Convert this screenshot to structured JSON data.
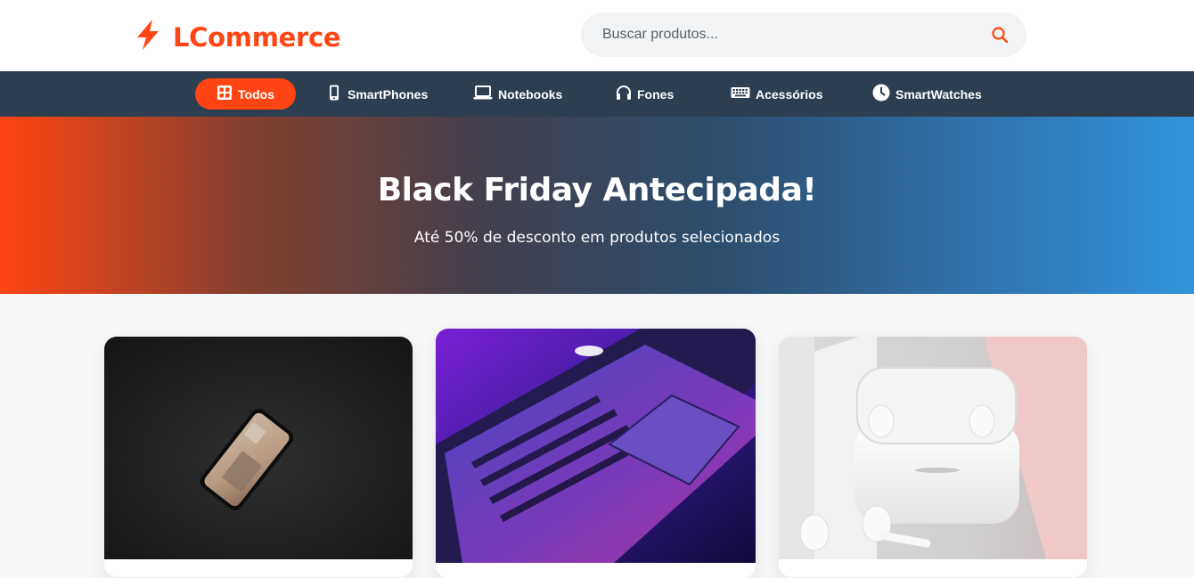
{
  "header": {
    "logo_text": "LCommerce",
    "search": {
      "placeholder": "Buscar produtos...",
      "value": ""
    }
  },
  "nav": {
    "items": [
      {
        "label": "Todos",
        "icon": "grid-icon",
        "active": true
      },
      {
        "label": "SmartPhones",
        "icon": "phone-icon"
      },
      {
        "label": "Notebooks",
        "icon": "laptop-icon"
      },
      {
        "label": "Fones",
        "icon": "headphones-icon"
      },
      {
        "label": "Acessórios",
        "icon": "keyboard-icon"
      },
      {
        "label": "SmartWatches",
        "icon": "clock-icon"
      }
    ]
  },
  "banner": {
    "title": "Black Friday Antecipada!",
    "subtitle": "Até 50% de desconto em produtos selecionados"
  },
  "products": [
    {
      "image": "smartphone-image"
    },
    {
      "image": "laptop-image"
    },
    {
      "image": "earbuds-image"
    }
  ],
  "colors": {
    "accent": "#ff4513",
    "nav_bg": "#2c3e50",
    "banner_start": "#ff4513",
    "banner_end": "#3394dc"
  }
}
